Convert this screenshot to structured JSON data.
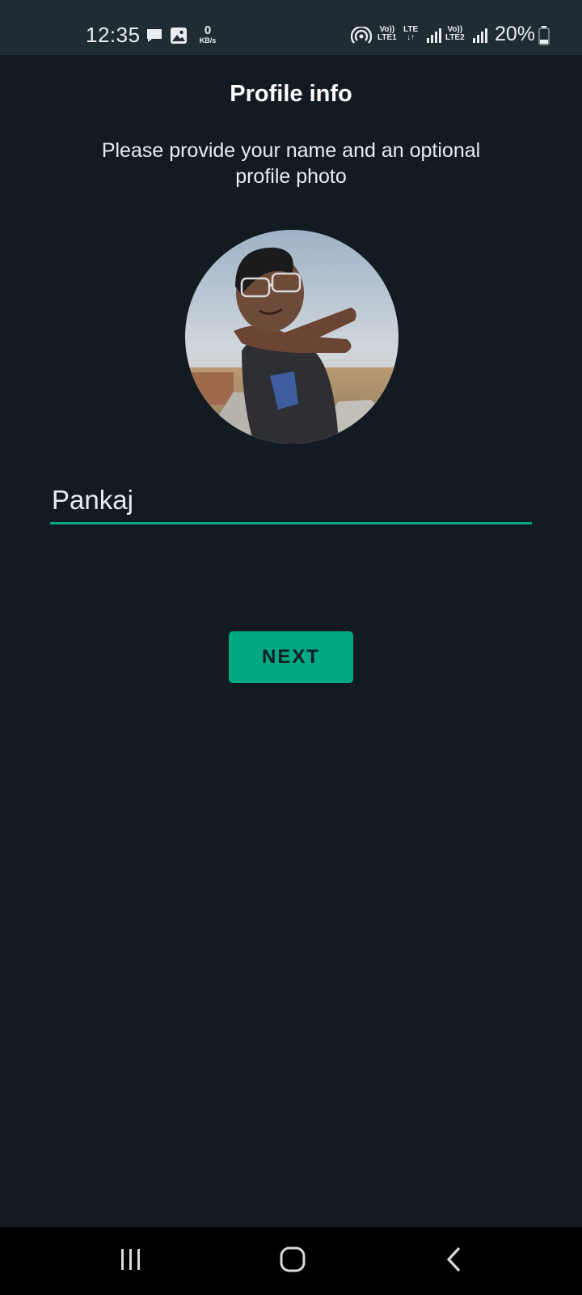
{
  "status_bar": {
    "time": "12:35",
    "speed_value": "0",
    "speed_unit": "KB/s",
    "sim1_top": "Vo))",
    "sim1_bottom": "LTE1",
    "lte_top": "LTE",
    "lte_bottom": "↓↑",
    "sim2_top": "Vo))",
    "sim2_bottom": "LTE2",
    "battery": "20%",
    "icons": [
      "message-icon",
      "gallery-icon",
      "hotspot-icon",
      "signal-icon",
      "battery-icon"
    ]
  },
  "header": {
    "title": "Profile info",
    "subtitle": "Please provide your name and an optional profile photo"
  },
  "profile": {
    "photo": "profile-photo"
  },
  "name_field": {
    "value": "Pankaj",
    "accent": "#00a884"
  },
  "actions": {
    "next_label": "NEXT"
  },
  "nav_bar": {
    "icons": [
      "recent-apps-icon",
      "home-icon",
      "back-icon"
    ]
  },
  "colors": {
    "background": "#121b22",
    "status_bar": "#1f2c34",
    "accent": "#00a884"
  }
}
